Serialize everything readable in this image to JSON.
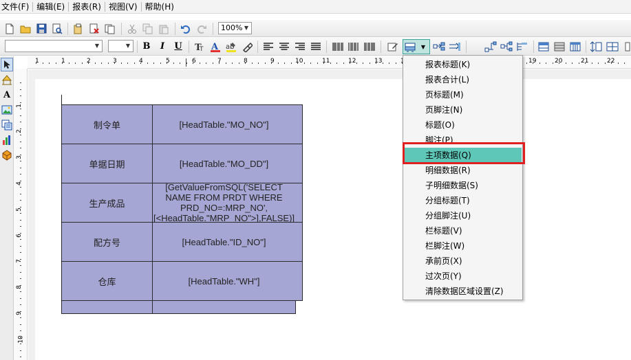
{
  "menubar": {
    "items": [
      "文件(F)",
      "编辑(E)",
      "报表(R)",
      "视图(V)",
      "帮助(H)"
    ]
  },
  "toolbar1": {
    "zoom": "100%",
    "icons": [
      "new-icon",
      "open-icon",
      "save-icon",
      "print-preview-icon",
      "paste-special-icon",
      "delete-icon",
      "copy-page-icon",
      "cut-icon",
      "copy-icon",
      "paste-icon",
      "undo-icon",
      "redo-icon"
    ]
  },
  "toolbar2": {
    "font_family_value": "",
    "font_size_value": "",
    "bold_label": "B",
    "italic_label": "I",
    "underline_label": "U"
  },
  "ruler": {
    "h_labels": [
      "1",
      "1",
      "2",
      "3",
      "4",
      "5",
      "6",
      "7",
      "8",
      "9",
      "10",
      "11",
      "12",
      "13",
      "14",
      "19",
      "20",
      "21",
      "22"
    ],
    "v_labels": [
      "1",
      "2",
      "3",
      "4",
      "5",
      "6",
      "7",
      "8",
      "9",
      "10"
    ]
  },
  "report": {
    "rows": [
      {
        "label": "制令单",
        "value": "[HeadTable.\"MO_NO\"]"
      },
      {
        "label": "单据日期",
        "value": "[HeadTable.\"MO_DD\"]"
      },
      {
        "label": "生产成品",
        "value": "[GetValueFromSQL('SELECT NAME FROM PRDT WHERE PRD_NO=:MRP_NO',[<HeadTable.\"MRP_NO\">],FALSE)]"
      },
      {
        "label": "配方号",
        "value": "[HeadTable.\"ID_NO\"]"
      },
      {
        "label": "仓库",
        "value": "[HeadTable.\"WH\"]"
      }
    ]
  },
  "dropdown": {
    "items": [
      "报表标题(K)",
      "报表合计(L)",
      "页标题(M)",
      "页脚注(N)",
      "标题(O)",
      "脚注(P)",
      "主项数据(Q)",
      "明细数据(R)",
      "子明细数据(S)",
      "分组标题(T)",
      "分组脚注(U)",
      "栏标题(V)",
      "栏脚注(W)",
      "承前页(X)",
      "过次页(Y)",
      "清除数据区域设置(Z)"
    ],
    "selected_index": 6
  },
  "colors": {
    "cell_fill": "#a6a6d4",
    "menu_selected": "#5ec7b8",
    "highlight_border": "#e02020"
  }
}
